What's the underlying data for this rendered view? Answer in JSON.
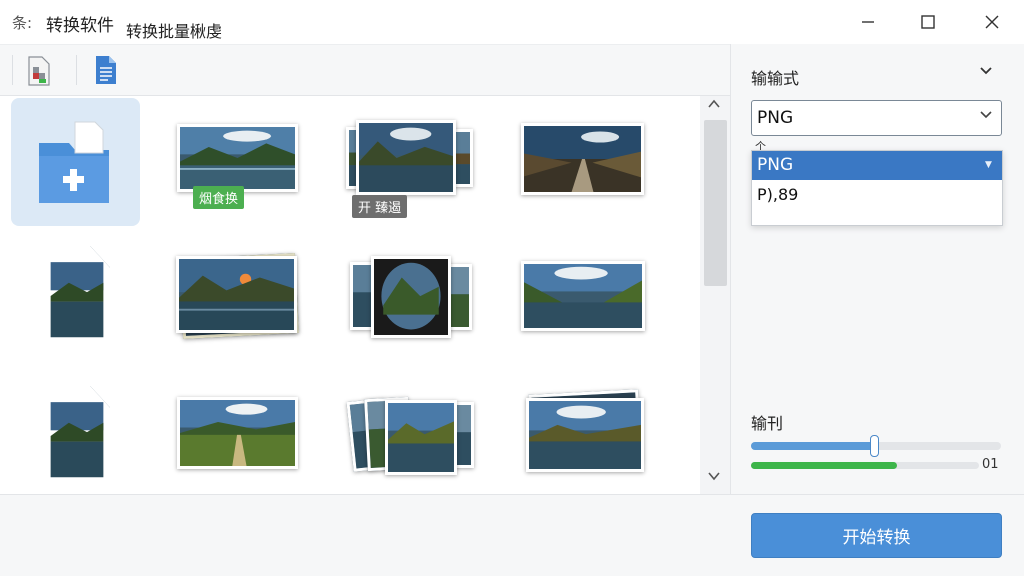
{
  "window": {
    "icon_text": "条:",
    "title": "转换软件"
  },
  "toolbar": {
    "batch_label": "转换批量楸虔"
  },
  "grid": {
    "add_tile_icon": "folder-plus-icon",
    "badges": {
      "item_2": "烟食换",
      "item_3": "开 臻遏"
    }
  },
  "right_panel": {
    "output_format_label": "输输式",
    "format_select_value": "PNG",
    "dropdown": {
      "selected_option": "PNG",
      "other_option": "P),89"
    },
    "small_mark": "个",
    "quality_label": "输刊",
    "quality_level": 0.49,
    "progress_level": 0.64,
    "progress_value_text": "01"
  },
  "footer": {
    "start_button_label": "开始转换"
  },
  "colors": {
    "accent_blue": "#4a8fd8",
    "selection_blue": "#3a78c4",
    "progress_green": "#3db54a",
    "badge_green": "#4caf50"
  }
}
